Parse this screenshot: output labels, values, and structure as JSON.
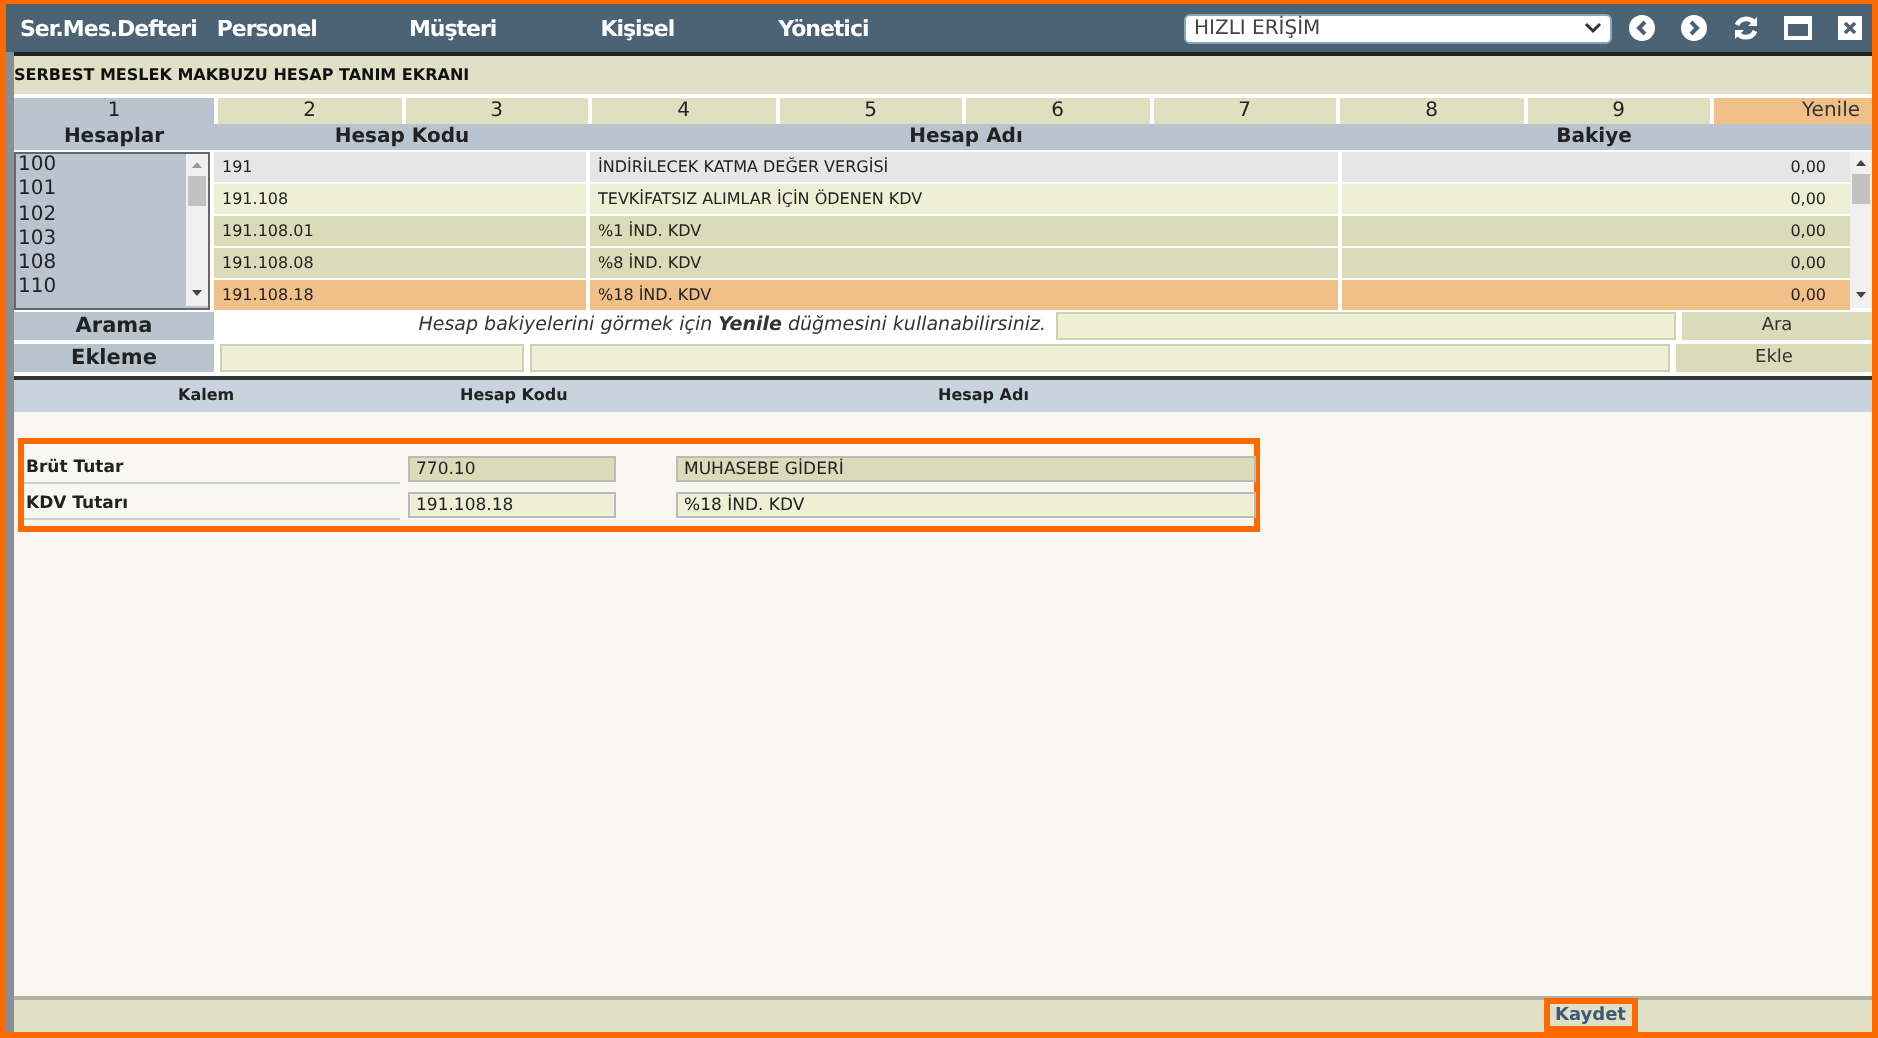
{
  "menu": {
    "brand": "Ser.Mes.Defteri",
    "items": [
      "Personel",
      "Müşteri",
      "Kişisel",
      "Yönetici"
    ],
    "quick_access": {
      "value": "HIZLI ERİŞİM"
    }
  },
  "page_title": "SERBEST MESLEK MAKBUZU HESAP TANIM EKRANI",
  "tabs": [
    {
      "label": "1",
      "selected": true
    },
    {
      "label": "2",
      "selected": false
    },
    {
      "label": "3",
      "selected": false
    },
    {
      "label": "4",
      "selected": false
    },
    {
      "label": "5",
      "selected": false
    },
    {
      "label": "6",
      "selected": false
    },
    {
      "label": "7",
      "selected": false
    },
    {
      "label": "8",
      "selected": false
    },
    {
      "label": "9",
      "selected": false
    }
  ],
  "refresh_button": "Yenile",
  "accounts_list": {
    "heading": "Hesaplar",
    "items": [
      "100",
      "101",
      "102",
      "103",
      "108",
      "110"
    ]
  },
  "table": {
    "columns": [
      "Hesap Kodu",
      "Hesap Adı",
      "Bakiye"
    ],
    "rows": [
      {
        "code": "191",
        "name": "İNDİRİLECEK KATMA DEĞER VERGİSİ",
        "balance": "0,00",
        "color": "#e6e6e6",
        "selected": false
      },
      {
        "code": "191.108",
        "name": "TEVKİFATSIZ ALIMLAR İÇİN ÖDENEN KDV",
        "balance": "0,00",
        "color": "#eef0d6",
        "selected": false
      },
      {
        "code": "191.108.01",
        "name": "%1 İND. KDV",
        "balance": "0,00",
        "color": "#dadbb9",
        "selected": false
      },
      {
        "code": "191.108.08",
        "name": "%8 İND. KDV",
        "balance": "0,00",
        "color": "#dadbb9",
        "selected": false
      },
      {
        "code": "191.108.18",
        "name": "%18 İND. KDV",
        "balance": "0,00",
        "selected": true
      }
    ]
  },
  "search": {
    "label": "Arama",
    "hint": "Hesap bakiyelerini görmek için **Yenile** düğmesini kullanabilirsiniz.",
    "button": "Ara"
  },
  "add": {
    "label": "Ekleme",
    "button": "Ekle"
  },
  "items_table": {
    "columns": [
      "Kalem",
      "Hesap Kodu",
      "Hesap Adı"
    ],
    "rows": [
      {
        "item": "Brüt Tutar",
        "code": "770.10",
        "name": "MUHASEBE GİDERİ"
      },
      {
        "item": "KDV Tutarı",
        "code": "191.108.18",
        "name": "%18 İND. KDV"
      }
    ]
  },
  "save_button": "Kaydet"
}
